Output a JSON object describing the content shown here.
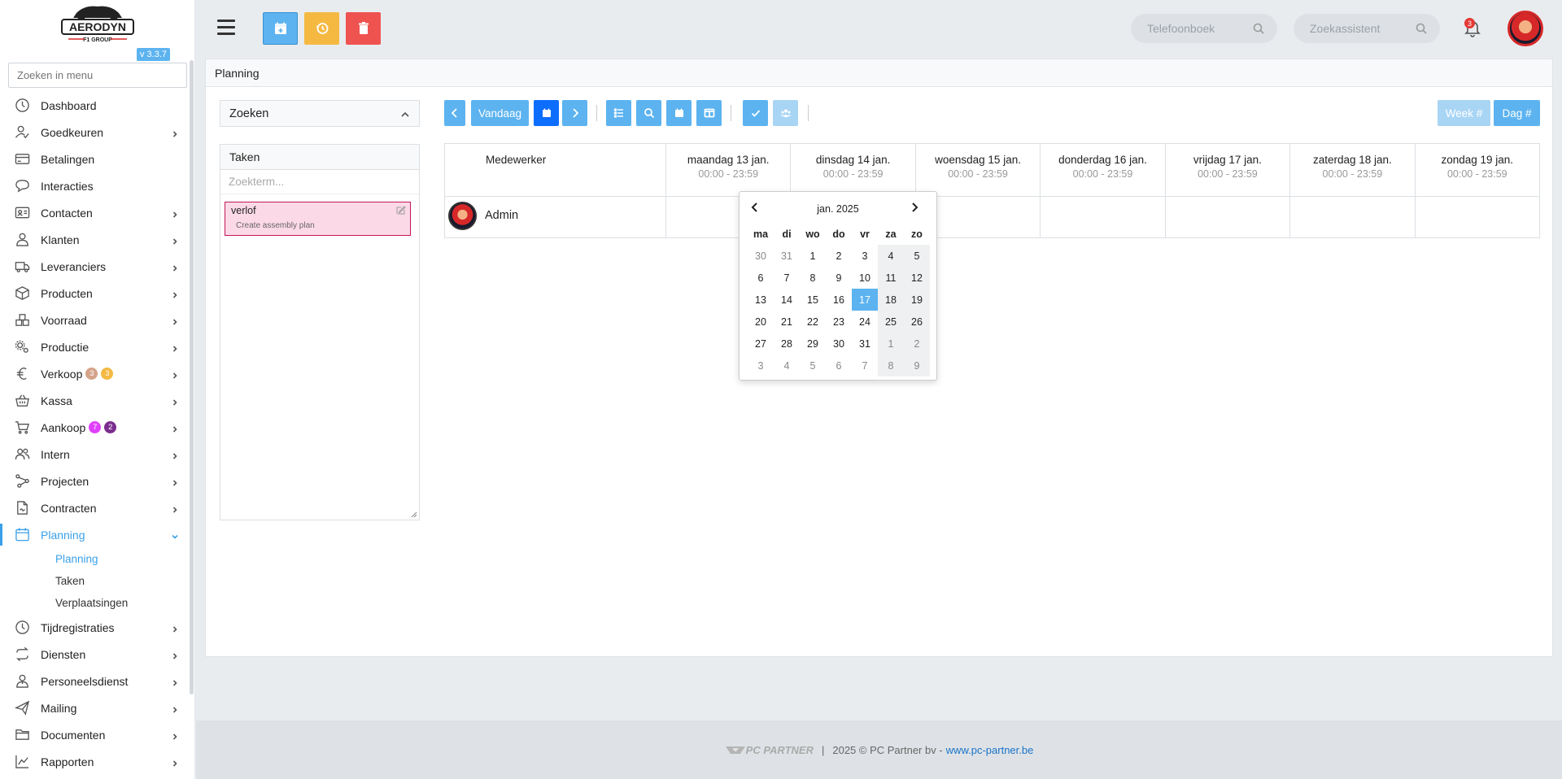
{
  "app": {
    "logo_text": "AERODYN",
    "logo_subtext": "F1 GROUP",
    "version": "v 3.3.7"
  },
  "sidebar": {
    "search_placeholder": "Zoeken in menu",
    "items": [
      {
        "label": "Dashboard",
        "icon": "dashboard-icon",
        "chevron": false
      },
      {
        "label": "Goedkeuren",
        "icon": "user-check-icon",
        "chevron": true
      },
      {
        "label": "Betalingen",
        "icon": "credit-card-icon",
        "chevron": false
      },
      {
        "label": "Interacties",
        "icon": "chat-icon",
        "chevron": false
      },
      {
        "label": "Contacten",
        "icon": "id-card-icon",
        "chevron": true
      },
      {
        "label": "Klanten",
        "icon": "user-icon",
        "chevron": true
      },
      {
        "label": "Leveranciers",
        "icon": "truck-icon",
        "chevron": true
      },
      {
        "label": "Producten",
        "icon": "box-icon",
        "chevron": true
      },
      {
        "label": "Voorraad",
        "icon": "boxes-icon",
        "chevron": true
      },
      {
        "label": "Productie",
        "icon": "gears-icon",
        "chevron": true
      },
      {
        "label": "Verkoop",
        "icon": "euro-icon",
        "chevron": true,
        "badges": [
          {
            "text": "3",
            "color": "#d4a38a"
          },
          {
            "text": "3",
            "color": "#f5b942"
          }
        ]
      },
      {
        "label": "Kassa",
        "icon": "basket-icon",
        "chevron": true
      },
      {
        "label": "Aankoop",
        "icon": "cart-icon",
        "chevron": true,
        "badges": [
          {
            "text": "7",
            "color": "#e040fb"
          },
          {
            "text": "2",
            "color": "#7b2d8e"
          }
        ]
      },
      {
        "label": "Intern",
        "icon": "users-icon",
        "chevron": true
      },
      {
        "label": "Projecten",
        "icon": "project-icon",
        "chevron": true
      },
      {
        "label": "Contracten",
        "icon": "contract-icon",
        "chevron": true
      },
      {
        "label": "Planning",
        "icon": "calendar-icon",
        "chevron": true,
        "active": true,
        "sub": [
          {
            "label": "Planning",
            "active": true
          },
          {
            "label": "Taken"
          },
          {
            "label": "Verplaatsingen"
          }
        ]
      },
      {
        "label": "Tijdregistraties",
        "icon": "clock-icon",
        "chevron": true
      },
      {
        "label": "Diensten",
        "icon": "repeat-icon",
        "chevron": true
      },
      {
        "label": "Personeelsdienst",
        "icon": "staff-icon",
        "chevron": true
      },
      {
        "label": "Mailing",
        "icon": "send-icon",
        "chevron": true
      },
      {
        "label": "Documenten",
        "icon": "folder-icon",
        "chevron": true
      },
      {
        "label": "Rapporten",
        "icon": "chart-icon",
        "chevron": true
      }
    ]
  },
  "topbar": {
    "phonebook_placeholder": "Telefoonboek",
    "assistant_placeholder": "Zoekassistent",
    "notification_count": "3",
    "colors": {
      "blue": "#5cb3f0",
      "yellow": "#f5b942",
      "red": "#ef5350"
    }
  },
  "page": {
    "title": "Planning",
    "search_label": "Zoeken",
    "tasks_label": "Taken",
    "tasks_search_placeholder": "Zoekterm...",
    "task": {
      "title": "verlof",
      "description": "Create assembly plan"
    }
  },
  "toolbar": {
    "today": "Vandaag",
    "week": "Week #",
    "day": "Dag #"
  },
  "calendar": {
    "employee_header": "Medewerker",
    "employee_name": "Admin",
    "days": [
      {
        "label": "maandag 13 jan.",
        "hours": "00:00 - 23:59"
      },
      {
        "label": "dinsdag 14 jan.",
        "hours": "00:00 - 23:59"
      },
      {
        "label": "woensdag 15 jan.",
        "hours": "00:00 - 23:59"
      },
      {
        "label": "donderdag 16 jan.",
        "hours": "00:00 - 23:59"
      },
      {
        "label": "vrijdag 17 jan.",
        "hours": "00:00 - 23:59"
      },
      {
        "label": "zaterdag 18 jan.",
        "hours": "00:00 - 23:59"
      },
      {
        "label": "zondag 19 jan.",
        "hours": "00:00 - 23:59"
      }
    ]
  },
  "datepicker": {
    "month_label": "jan. 2025",
    "weekdays": [
      "ma",
      "di",
      "wo",
      "do",
      "vr",
      "za",
      "zo"
    ],
    "weeks": [
      [
        {
          "d": "30",
          "o": 1
        },
        {
          "d": "31",
          "o": 1
        },
        {
          "d": "1"
        },
        {
          "d": "2"
        },
        {
          "d": "3"
        },
        {
          "d": "4"
        },
        {
          "d": "5"
        }
      ],
      [
        {
          "d": "6"
        },
        {
          "d": "7"
        },
        {
          "d": "8"
        },
        {
          "d": "9"
        },
        {
          "d": "10"
        },
        {
          "d": "11"
        },
        {
          "d": "12"
        }
      ],
      [
        {
          "d": "13"
        },
        {
          "d": "14"
        },
        {
          "d": "15"
        },
        {
          "d": "16"
        },
        {
          "d": "17",
          "s": 1
        },
        {
          "d": "18"
        },
        {
          "d": "19"
        }
      ],
      [
        {
          "d": "20"
        },
        {
          "d": "21"
        },
        {
          "d": "22"
        },
        {
          "d": "23"
        },
        {
          "d": "24"
        },
        {
          "d": "25"
        },
        {
          "d": "26"
        }
      ],
      [
        {
          "d": "27"
        },
        {
          "d": "28"
        },
        {
          "d": "29"
        },
        {
          "d": "30"
        },
        {
          "d": "31"
        },
        {
          "d": "1",
          "o": 1
        },
        {
          "d": "2",
          "o": 1
        }
      ],
      [
        {
          "d": "3",
          "o": 1
        },
        {
          "d": "4",
          "o": 1
        },
        {
          "d": "5",
          "o": 1
        },
        {
          "d": "6",
          "o": 1
        },
        {
          "d": "7",
          "o": 1
        },
        {
          "d": "8",
          "o": 1
        },
        {
          "d": "9",
          "o": 1
        }
      ]
    ]
  },
  "footer": {
    "brand": "PC PARTNER",
    "separator": "|",
    "copyright": "2025 © PC Partner bv -",
    "link": "www.pc-partner.be"
  }
}
